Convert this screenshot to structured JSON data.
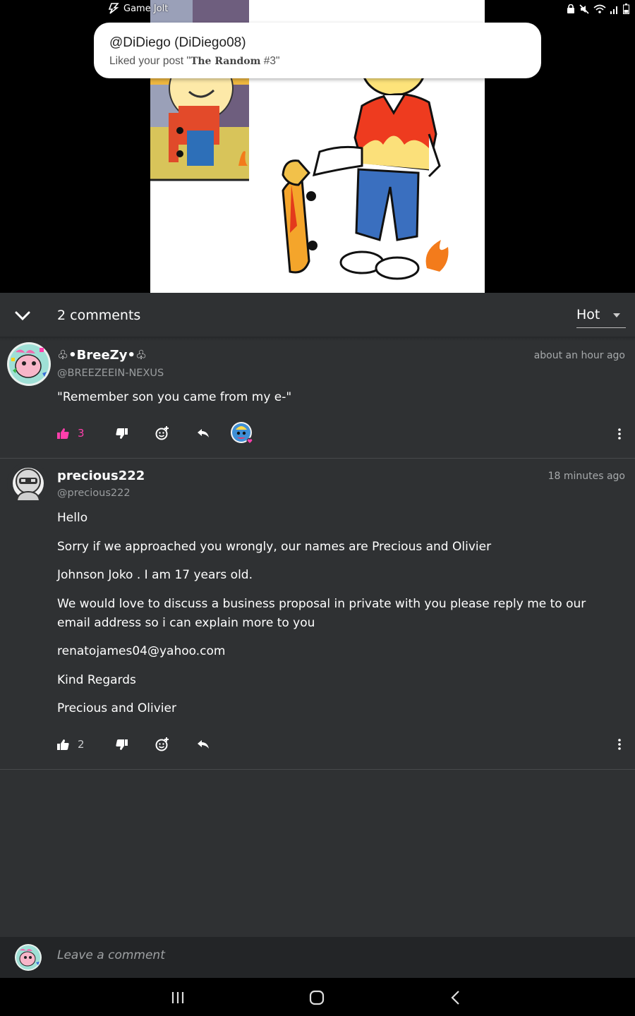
{
  "status_bar": {
    "app_name": "Game Jolt",
    "icons": [
      "lock-icon",
      "mute-icon",
      "wifi-icon",
      "signal-icon",
      "battery-icon"
    ]
  },
  "notification": {
    "title": "@DiDiego (DiDiego08)",
    "body_prefix": "Liked your post \"",
    "post_title": "The Random",
    "post_suffix": " #3\""
  },
  "comments_header": {
    "count_label": "2 comments",
    "sort_value": "Hot"
  },
  "comments": [
    {
      "display_name": "♧•BreeZy•♧",
      "handle": "@BREEZEEIN-NEXUS",
      "timestamp": "about an hour ago",
      "paragraphs": [
        "\"Remember son you came from my e-\""
      ],
      "likes": "3",
      "liked": true
    },
    {
      "display_name": "precious222",
      "handle": "@precious222",
      "timestamp": "18 minutes ago",
      "paragraphs": [
        "Hello",
        "Sorry if we approached you wrongly, our names are Precious and Olivier",
        "Johnson Joko . I am 17 years old.",
        "We would love to discuss a business proposal in private with you please reply me to our email address so i can explain more to you",
        "renatojames04@yahoo.com",
        "Kind Regards",
        "Precious and Olivier"
      ],
      "likes": "2",
      "liked": false
    }
  ],
  "compose": {
    "placeholder": "Leave a comment"
  },
  "colors": {
    "like_active": "#ff3fac",
    "panel_bg": "#2f3133",
    "compose_bg": "#232527"
  }
}
